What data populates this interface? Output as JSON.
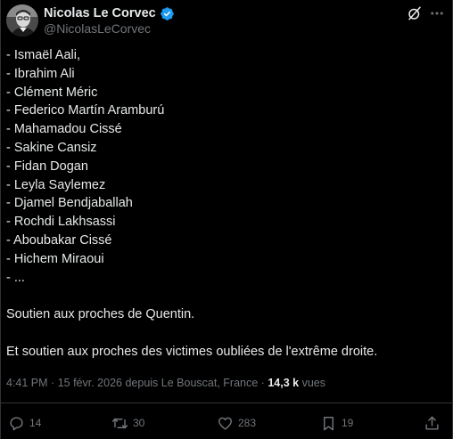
{
  "author": {
    "display_name": "Nicolas Le Corvec",
    "handle": "@NicolasLeCorvec"
  },
  "tweet": {
    "list_lines": [
      "- Ismaël Aali,",
      "- Ibrahim Ali",
      "- Clément Méric",
      "- Federico Martín Aramburú",
      "- Mahamadou Cissé",
      "- Sakine Cansiz",
      "- Fidan Dogan",
      "- Leyla Saylemez",
      "- Djamel Bendjaballah",
      "- Rochdi Lakhsassi",
      "- Aboubakar Cissé",
      "- Hichem Miraoui",
      "- ..."
    ],
    "paragraph_1": "Soutien aux proches de Quentin.",
    "paragraph_2": "Et soutien aux proches des victimes oubliées de l'extrême droite."
  },
  "meta": {
    "time": "4:41 PM",
    "separator": "·",
    "date": "15 févr. 2026",
    "location": "depuis Le Bouscat, France",
    "views_count": "14,3 k",
    "views_label": "vues"
  },
  "actions": {
    "replies": "14",
    "reposts": "30",
    "likes": "283",
    "bookmarks": "19"
  },
  "colors": {
    "background": "#000000",
    "text": "#e7e9ea",
    "secondary": "#71767b",
    "border": "#2f3336",
    "verified": "#1d9bf0"
  },
  "icons": {
    "verified": "verified-badge-icon",
    "grok": "grok-icon",
    "more": "more-icon",
    "reply": "reply-icon",
    "repost": "repost-icon",
    "like": "like-icon",
    "bookmark": "bookmark-icon",
    "share": "share-icon"
  }
}
